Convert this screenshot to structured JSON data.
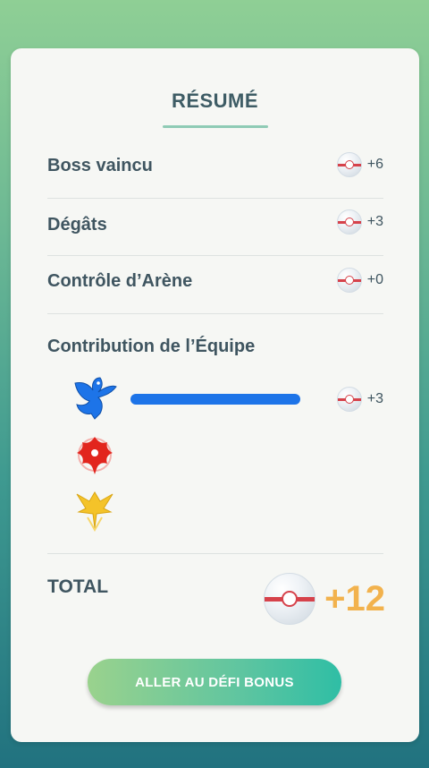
{
  "summary": {
    "title": "RÉSUMÉ",
    "rows": [
      {
        "label": "Boss vaincu",
        "value": "+6",
        "icon": "premier-ball-icon"
      },
      {
        "label": "Dégâts",
        "value": "+3",
        "icon": "premier-ball-icon"
      },
      {
        "label": "Contrôle d’Arène",
        "value": "+0",
        "icon": "premier-ball-icon"
      }
    ],
    "team_contribution": {
      "label": "Contribution de l’Équipe",
      "teams": [
        {
          "name": "mystic",
          "icon": "team-mystic-icon",
          "color": "#1d74e8",
          "value": "+3",
          "progress": 1.0
        },
        {
          "name": "valor",
          "icon": "team-valor-icon",
          "color": "#e2251d"
        },
        {
          "name": "instinct",
          "icon": "team-instinct-icon",
          "color": "#f4c329"
        }
      ]
    },
    "total": {
      "label": "TOTAL",
      "value": "+12",
      "icon": "premier-ball-icon"
    }
  },
  "action_button": {
    "label": "ALLER AU DÉFI BONUS"
  }
}
